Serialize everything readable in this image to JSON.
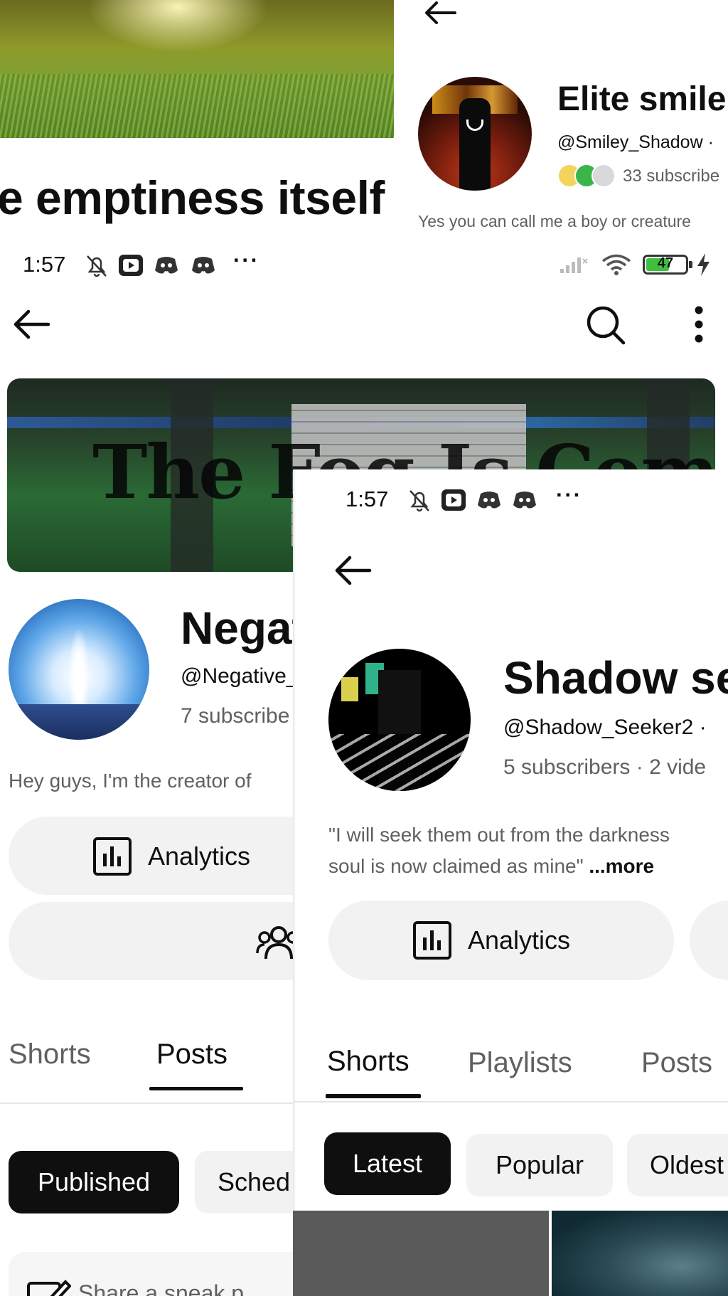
{
  "top_left": {
    "title": "e emptiness itself"
  },
  "top_right": {
    "channel_name": "Elite smile",
    "handle": "@Smiley_Shadow · ",
    "subscribers": "33 subscribe",
    "description": "Yes you can call me a boy or creature"
  },
  "main": {
    "status": {
      "time": "1:57",
      "more": "···",
      "battery": "47"
    },
    "banner_text": "The Fog Is Coming",
    "channel_name": "Negat",
    "handle": "@Negative_",
    "subscribers": "7 subscribe",
    "description": "Hey guys, I'm the creator of",
    "analytics_label": "Analytics",
    "tabs": [
      {
        "label": "Shorts"
      },
      {
        "label": "Posts"
      }
    ],
    "chips": [
      {
        "label": "Published"
      },
      {
        "label": "Sched"
      }
    ],
    "composer_placeholder": "Share a sneak p"
  },
  "overlay": {
    "status": {
      "time": "1:57",
      "more": "···"
    },
    "channel_name": "Shadow se",
    "handle": "@Shadow_Seeker2 ·",
    "subscribers": "5 subscribers · 2 vide",
    "description_line1": "\"I will seek them out from the darkness",
    "description_line2": "soul is now claimed as mine\" ",
    "more_label": "...more",
    "analytics_label": "Analytics",
    "tabs": [
      {
        "label": "Shorts"
      },
      {
        "label": "Playlists"
      },
      {
        "label": "Posts"
      }
    ],
    "chips": [
      {
        "label": "Latest"
      },
      {
        "label": "Popular"
      },
      {
        "label": "Oldest"
      }
    ]
  },
  "colors": {
    "text_primary": "#0f0f0f",
    "text_secondary": "#606060",
    "chip_active_bg": "#0f0f0f",
    "pill_bg": "#f2f2f2",
    "battery_green": "#3fbf3f"
  },
  "icons": {
    "back": "back-arrow-icon",
    "search": "search-icon",
    "more": "more-vertical-icon",
    "analytics": "bar-chart-icon",
    "manage": "people-icon",
    "bell_off": "bell-off-icon",
    "youtube": "youtube-icon",
    "discord": "discord-icon",
    "signal": "signal-icon",
    "wifi": "wifi-icon",
    "battery": "battery-icon",
    "charging": "charging-bolt-icon",
    "compose": "pencil-icon"
  }
}
